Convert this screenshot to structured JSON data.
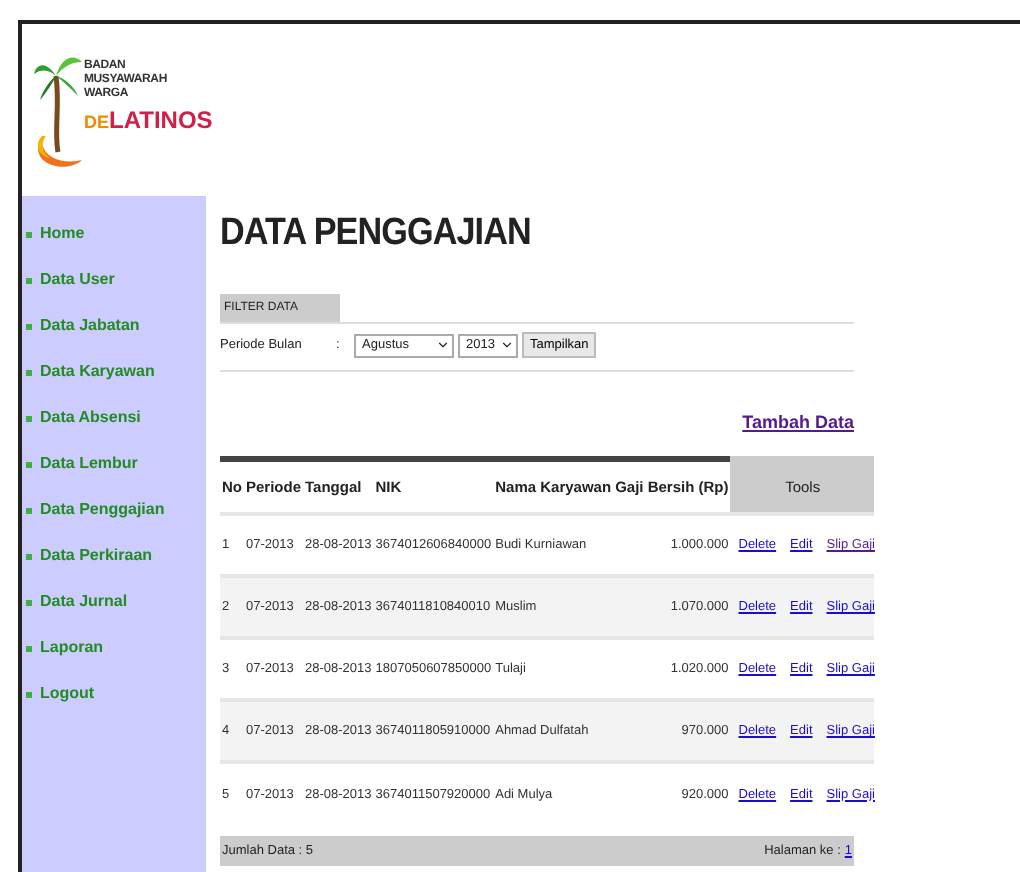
{
  "logo": {
    "lines": [
      "BADAN",
      "MUSYAWARAH",
      "WARGA"
    ],
    "brand_prefix": "DE",
    "brand_name": "LATINOS"
  },
  "sidebar": {
    "items": [
      {
        "label": "Home"
      },
      {
        "label": "Data User"
      },
      {
        "label": "Data Jabatan"
      },
      {
        "label": "Data Karyawan"
      },
      {
        "label": "Data Absensi"
      },
      {
        "label": "Data Lembur"
      },
      {
        "label": "Data Penggajian"
      },
      {
        "label": "Data Perkiraan"
      },
      {
        "label": "Data Jurnal"
      },
      {
        "label": "Laporan"
      },
      {
        "label": "Logout"
      }
    ]
  },
  "page_title": "DATA PENGGAJIAN",
  "filter": {
    "heading": "FILTER DATA",
    "label": "Periode Bulan",
    "separator": ":",
    "month": "Agustus",
    "year": "2013",
    "button": "Tampilkan"
  },
  "add_link": {
    "label": "Tambah Data",
    "visited": true
  },
  "table": {
    "columns": [
      "No",
      "Periode",
      "Tanggal",
      "NIK",
      "Nama Karyawan",
      "Gaji Bersih (Rp)",
      "Tools"
    ],
    "rows": [
      {
        "cells": [
          "1",
          "07-2013",
          "28-08-2013",
          "3674012606840000",
          "Budi Kurniawan",
          "1.000.000"
        ],
        "actions": [
          {
            "label": "Delete",
            "visited": false
          },
          {
            "label": "Edit",
            "visited": false
          },
          {
            "label": "Slip Gaji",
            "visited": true
          }
        ]
      },
      {
        "cells": [
          "2",
          "07-2013",
          "28-08-2013",
          "3674011810840010",
          "Muslim",
          "1.070.000"
        ],
        "actions": [
          {
            "label": "Delete",
            "visited": false
          },
          {
            "label": "Edit",
            "visited": false
          },
          {
            "label": "Slip Gaji",
            "visited": false
          }
        ]
      },
      {
        "cells": [
          "3",
          "07-2013",
          "28-08-2013",
          "1807050607850000",
          "Tulaji",
          "1.020.000"
        ],
        "actions": [
          {
            "label": "Delete",
            "visited": false
          },
          {
            "label": "Edit",
            "visited": false
          },
          {
            "label": "Slip Gaji",
            "visited": false
          }
        ]
      },
      {
        "cells": [
          "4",
          "07-2013",
          "28-08-2013",
          "3674011805910000",
          "Ahmad Dulfatah",
          "970.000"
        ],
        "actions": [
          {
            "label": "Delete",
            "visited": false
          },
          {
            "label": "Edit",
            "visited": false
          },
          {
            "label": "Slip Gaji",
            "visited": false
          }
        ]
      },
      {
        "cells": [
          "5",
          "07-2013",
          "28-08-2013",
          "3674011507920000",
          "Adi Mulya",
          "920.000"
        ],
        "actions": [
          {
            "label": "Delete",
            "visited": false
          },
          {
            "label": "Edit",
            "visited": false
          },
          {
            "label": "Slip Gaji",
            "visited": false
          }
        ]
      }
    ]
  },
  "footer": {
    "count": "Jumlah Data : 5",
    "page_label": "Halaman ke :",
    "pages": [
      "1"
    ]
  }
}
